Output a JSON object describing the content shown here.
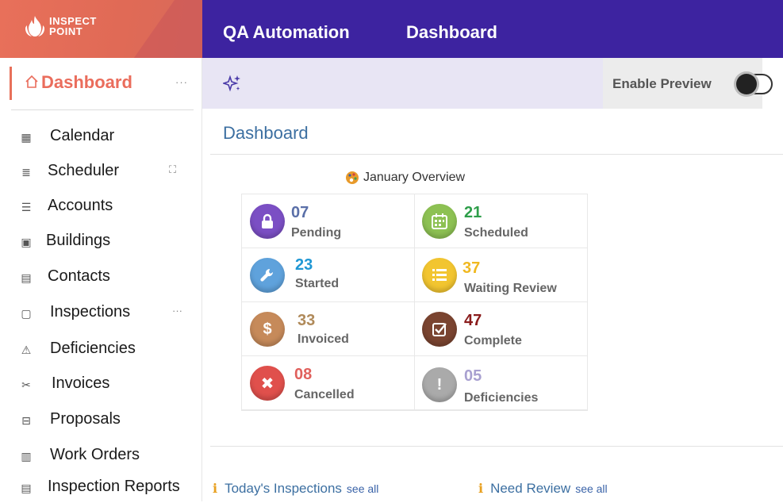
{
  "brand": {
    "line1": "INSPECT",
    "line2": "POINT"
  },
  "topbar": {
    "org": "QA Automation",
    "page": "Dashboard"
  },
  "subbar": {
    "preview_label": "Enable Preview"
  },
  "sidebar": {
    "active": {
      "label": "Dashboard",
      "more": "···"
    },
    "items": [
      {
        "label": "Calendar"
      },
      {
        "label": "Scheduler"
      },
      {
        "label": "Accounts"
      },
      {
        "label": "Buildings"
      },
      {
        "label": "Contacts"
      },
      {
        "label": "Inspections",
        "more": "···"
      },
      {
        "label": "Deficiencies"
      },
      {
        "label": "Invoices"
      },
      {
        "label": "Proposals"
      },
      {
        "label": "Work Orders"
      },
      {
        "label": "Inspection Reports"
      }
    ]
  },
  "content": {
    "title": "Dashboard",
    "overview": "January Overview"
  },
  "stats": [
    {
      "value": "07",
      "label": "Pending",
      "color": "#7b4fc4",
      "numColor": "#5a6fa8"
    },
    {
      "value": "21",
      "label": "Scheduled",
      "color": "#8dc153",
      "numColor": "#2e9e4a"
    },
    {
      "value": "23",
      "label": "Started",
      "color": "#5fa2dc",
      "numColor": "#1f97d4"
    },
    {
      "value": "37",
      "label": "Waiting Review",
      "color": "#f2c530",
      "numColor": "#f0b820"
    },
    {
      "value": "33",
      "label": "Invoiced",
      "color": "#c68a5a",
      "numColor": "#b08a5a"
    },
    {
      "value": "47",
      "label": "Complete",
      "color": "#7a4430",
      "numColor": "#8a1c1c"
    },
    {
      "value": "08",
      "label": "Cancelled",
      "color": "#e0504c",
      "numColor": "#e0605c"
    },
    {
      "value": "05",
      "label": "Deficiencies",
      "color": "#aaaaaa",
      "numColor": "#a8a0d0"
    }
  ],
  "footer": {
    "todays": {
      "label": "Today's Inspections",
      "see_all": "see all"
    },
    "review": {
      "label": "Need Review",
      "see_all": "see all"
    },
    "info_glyph": "i"
  }
}
